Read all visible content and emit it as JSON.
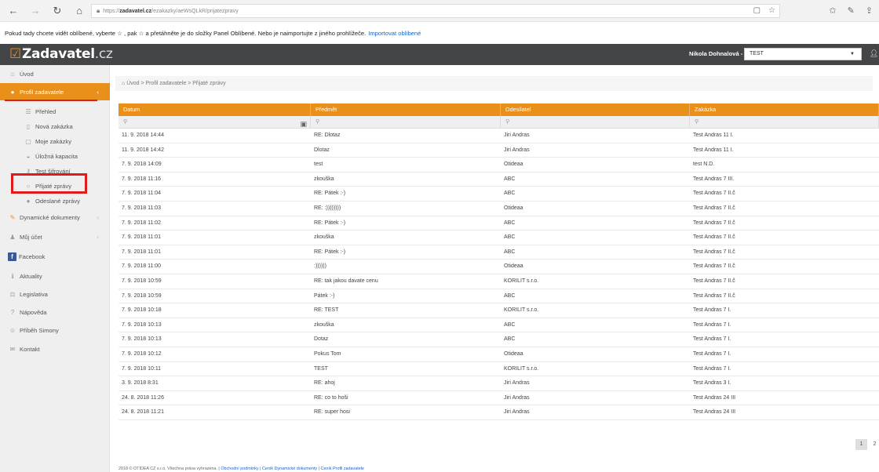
{
  "browser": {
    "url_prefix": "https://",
    "url_domain": "zadavatel.cz",
    "url_path": "/ezakazky/aeWsQLkR/prijatezpravy",
    "fav_bar_text": "Pokud tady chcete vidět oblíbené, vyberte ☆ , pak ☆ a přetáhněte je do složky Panel Oblíbené. Nebo je naimportujte z jiného prohlížeče.",
    "fav_bar_link": "Importovat oblíbené"
  },
  "header": {
    "logo_main": "Zadavatel",
    "logo_suffix": ".cz",
    "user_name": "Nikola Dohnalová -",
    "user_select_value": "TEST"
  },
  "sidebar": {
    "items": [
      {
        "label": "Úvod",
        "icon": "home-icon"
      },
      {
        "label": "Profil zadavatele",
        "icon": "profile-icon"
      },
      {
        "label": "Přehled",
        "icon": "list-icon"
      },
      {
        "label": "Nová zakázka",
        "icon": "document-icon"
      },
      {
        "label": "Moje zakázky",
        "icon": "folder-icon"
      },
      {
        "label": "Úložná kapacita",
        "icon": "storage-icon"
      },
      {
        "label": "Test šifrování",
        "icon": "key-icon"
      },
      {
        "label": "Přijaté zprávy",
        "icon": "chat-icon"
      },
      {
        "label": "Odeslané zprávy",
        "icon": "chat-sent-icon"
      },
      {
        "label": "Dynamické dokumenty",
        "icon": "edit-icon"
      },
      {
        "label": "Můj účet",
        "icon": "user-icon"
      },
      {
        "label": "Facebook",
        "icon": "facebook-icon"
      },
      {
        "label": "Aktuality",
        "icon": "info-icon"
      },
      {
        "label": "Legislativa",
        "icon": "gavel-icon"
      },
      {
        "label": "Nápověda",
        "icon": "help-icon"
      },
      {
        "label": "Příběh Simony",
        "icon": "person-icon"
      },
      {
        "label": "Kontakt",
        "icon": "mail-icon"
      }
    ]
  },
  "breadcrumb": {
    "text": "Úvod > Profil zadavatele > Přijaté zprávy"
  },
  "table": {
    "headers": [
      "Datum",
      "Předmět",
      "Odesílatel",
      "Zakázka"
    ],
    "rows": [
      [
        "11. 9. 2018 14:44",
        "RE: Dlotaz",
        "Jiri Andras",
        "Test Andras 11 I."
      ],
      [
        "11. 9. 2018 14:42",
        "Dlotaz",
        "Jiri Andras",
        "Test Andras 11 I."
      ],
      [
        "7. 9. 2018 14:09",
        "test",
        "Otideaa",
        "test N.D."
      ],
      [
        "7. 9. 2018 11:16",
        "zkouška",
        "ABC",
        "Test Andras 7 III."
      ],
      [
        "7. 9. 2018 11:04",
        "RE: Pátek :-)",
        "ABC",
        "Test Andras 7 II.č"
      ],
      [
        "7. 9. 2018 11:03",
        "RE: :))))))))",
        "Otideaa",
        "Test Andras 7 II.č"
      ],
      [
        "7. 9. 2018 11:02",
        "RE: Pátek :-)",
        "ABC",
        "Test Andras 7 II.č"
      ],
      [
        "7. 9. 2018 11:01",
        "zkouška",
        "ABC",
        "Test Andras 7 II.č"
      ],
      [
        "7. 9. 2018 11:01",
        "RE: Pátek :-)",
        "ABC",
        "Test Andras 7 II.č"
      ],
      [
        "7. 9. 2018 11:00",
        ":))))))",
        "Otideaa",
        "Test Andras 7 II.č"
      ],
      [
        "7. 9. 2018 10:59",
        "RE: tak jakou davate cenu",
        "KORILIT s.r.o.",
        "Test Andras 7 II.č"
      ],
      [
        "7. 9. 2018 10:59",
        "Pátek :-)",
        "ABC",
        "Test Andras 7 II.č"
      ],
      [
        "7. 9. 2018 10:18",
        "RE: TEST",
        "KORILIT s.r.o.",
        "Test Andras 7 I."
      ],
      [
        "7. 9. 2018 10:13",
        "zkouška",
        "ABC",
        "Test Andras 7 I."
      ],
      [
        "7. 9. 2018 10:13",
        "Dotaz",
        "ABC",
        "Test Andras 7 I."
      ],
      [
        "7. 9. 2018 10:12",
        "Pokus Tom",
        "Otideaa",
        "Test Andras 7 I."
      ],
      [
        "7. 9. 2018 10:11",
        "TEST",
        "KORILIT s.r.o.",
        "Test Andras 7 I."
      ],
      [
        "3. 9. 2018 8:31",
        "RE: ahoj",
        "Jiri Andras",
        "Test Andras 3 I."
      ],
      [
        "24. 8. 2018 11:26",
        "RE: co to hoši",
        "Jiri Andras",
        "Test Andras 24 III"
      ],
      [
        "24. 8. 2018 11:21",
        "RE: super hosi",
        "Jiri Andras",
        "Test Andras 24 III"
      ]
    ]
  },
  "pagination": {
    "pages": [
      "1",
      "2"
    ],
    "current": "1"
  },
  "footer": {
    "copyright": "2018 © OTIDEA CZ s.r.o. Všechna práva vyhrazena. |",
    "links": [
      "Obchodní podmínky",
      "Ceník Dynamické dokumenty",
      "Ceník Profil zadavatele"
    ]
  },
  "colors": {
    "accent": "#e8901a",
    "header_bg": "#444546",
    "highlight": "#e01b1b"
  }
}
